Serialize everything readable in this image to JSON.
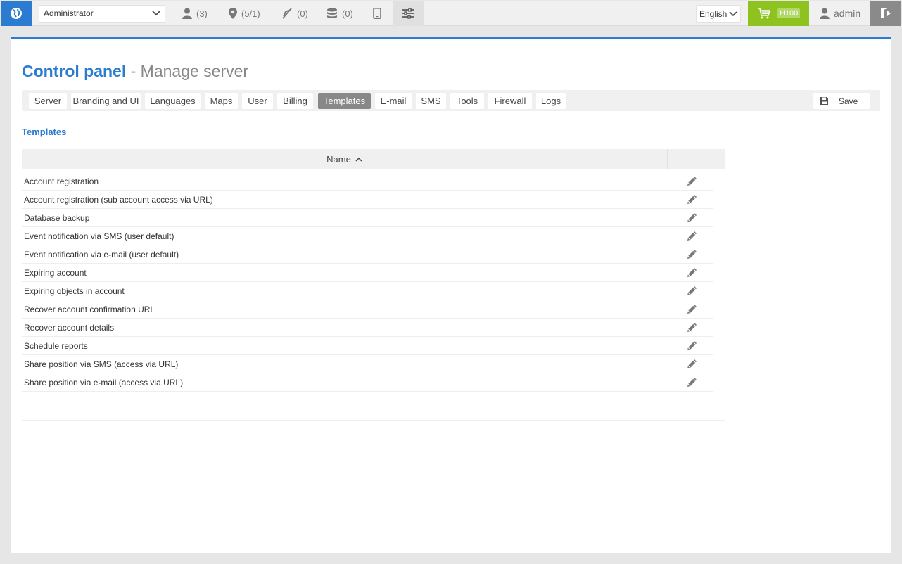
{
  "topbar": {
    "role": "Administrator",
    "counters": [
      {
        "name": "users",
        "value": "(3)"
      },
      {
        "name": "places",
        "value": "(5/1)"
      },
      {
        "name": "events",
        "value": "(0)"
      },
      {
        "name": "reports",
        "value": "(0)"
      }
    ],
    "language": "English",
    "cart_badge": "H100",
    "username": "admin",
    "colors": {
      "accent": "#2b7bd0",
      "cart": "#8dc21f",
      "logout": "#8a8a8a"
    }
  },
  "page": {
    "title": "Control panel",
    "subtitle": "- Manage server"
  },
  "tabs": [
    {
      "label": "Server"
    },
    {
      "label": "Branding and UI"
    },
    {
      "label": "Languages"
    },
    {
      "label": "Maps"
    },
    {
      "label": "User"
    },
    {
      "label": "Billing"
    },
    {
      "label": "Templates",
      "active": true
    },
    {
      "label": "E-mail"
    },
    {
      "label": "SMS"
    },
    {
      "label": "Tools"
    },
    {
      "label": "Firewall"
    },
    {
      "label": "Logs"
    }
  ],
  "save_label": "Save",
  "section": {
    "title": "Templates",
    "column_name": "Name",
    "sort": "ascending",
    "rows": [
      "Account registration",
      "Account registration (sub account access via URL)",
      "Database backup",
      "Event notification via SMS (user default)",
      "Event notification via e-mail (user default)",
      "Expiring account",
      "Expiring objects in account",
      "Recover account confirmation URL",
      "Recover account details",
      "Schedule reports",
      "Share position via SMS (access via URL)",
      "Share position via e-mail (access via URL)"
    ]
  }
}
